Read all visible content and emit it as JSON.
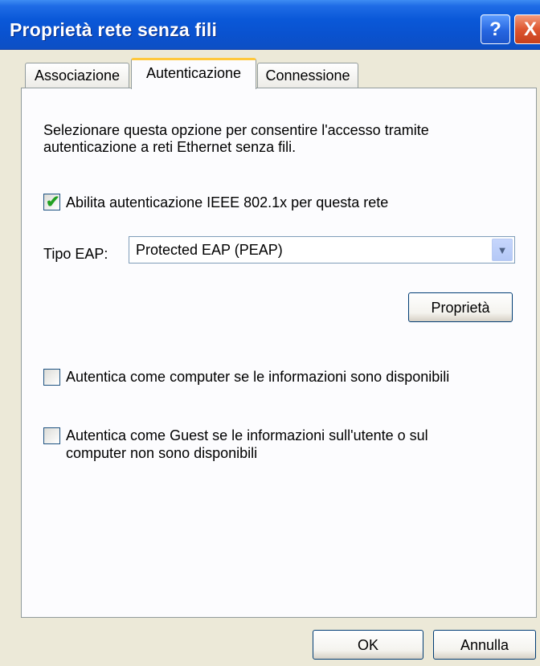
{
  "window": {
    "title": "Proprietà rete senza fili",
    "help_symbol": "?",
    "close_symbol": "X"
  },
  "tabs": [
    {
      "label": "Associazione",
      "selected": false
    },
    {
      "label": "Autenticazione",
      "selected": true
    },
    {
      "label": "Connessione",
      "selected": false
    }
  ],
  "auth": {
    "description": "Selezionare questa opzione per consentire l'accesso tramite autenticazione a reti Ethernet senza fili.",
    "enable_8021x": {
      "label": "Abilita autenticazione IEEE 802.1x per questa rete",
      "checked": true,
      "mark": "✔"
    },
    "eap_type_label": "Tipo EAP:",
    "eap_type_value": "Protected EAP (PEAP)",
    "properties_button": "Proprietà",
    "auth_as_computer": {
      "label": "Autentica come computer se le informazioni sono disponibili",
      "checked": false
    },
    "auth_as_guest": {
      "label_line1": "Autentica come Guest se le informazioni sull'utente o sul",
      "label_line2": "computer non sono disponibili",
      "checked": false
    }
  },
  "footer": {
    "ok_label": "OK",
    "cancel_label": "Annulla"
  },
  "colors": {
    "titlebar": "#0A58D8",
    "dialog_bg": "#ECE9D8",
    "tab_highlight": "#FFC83C",
    "checkmark": "#21A121"
  }
}
